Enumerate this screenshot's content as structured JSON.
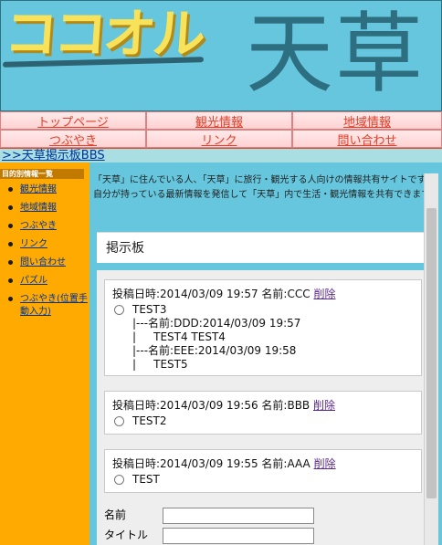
{
  "header": {
    "logo_text": "ココオル",
    "site_title": "天草"
  },
  "nav": {
    "items": [
      {
        "label": "トップページ"
      },
      {
        "label": "観光情報"
      },
      {
        "label": "地域情報"
      },
      {
        "label": "つぶやき"
      },
      {
        "label": "リンク"
      },
      {
        "label": "問い合わせ"
      }
    ]
  },
  "breadcrumb": ">>天草掲示板BBS",
  "sidebar": {
    "heading": "目的別情報一覧",
    "items": [
      {
        "label": "観光情報"
      },
      {
        "label": "地域情報"
      },
      {
        "label": "つぶやき"
      },
      {
        "label": "リンク"
      },
      {
        "label": "問い合わせ"
      },
      {
        "label": "パズル"
      },
      {
        "label": "つぶやき(位置手動入力)"
      }
    ]
  },
  "intro": {
    "line1": "「天草」に住んでいる人、「天草」に旅行・観光する人向けの情報共有サイトです。",
    "line2": "自分が持っている最新情報を発信して「天草」内で生活・観光情報を共有できます。"
  },
  "board": {
    "title": "掲示板",
    "delete_label": "削除",
    "posts": [
      {
        "meta": "投稿日時:2014/03/09 19:57 名前:CCC",
        "body": "TEST3",
        "replies": [
          "|---名前:DDD:2014/03/09 19:57",
          "|     TEST4 TEST4",
          "|---名前:EEE:2014/03/09 19:58",
          "|     TEST5"
        ]
      },
      {
        "meta": "投稿日時:2014/03/09 19:56 名前:BBB",
        "body": "TEST2",
        "replies": []
      },
      {
        "meta": "投稿日時:2014/03/09 19:55 名前:AAA",
        "body": "TEST",
        "replies": []
      }
    ]
  },
  "form": {
    "name_label": "名前",
    "name_value": "",
    "title_label": "タイトル",
    "title_value": ""
  },
  "colors": {
    "header_bg": "#66c6dd",
    "sidebar_bg": "#ffaa00",
    "nav_text": "#e0402a",
    "link": "#003399"
  }
}
